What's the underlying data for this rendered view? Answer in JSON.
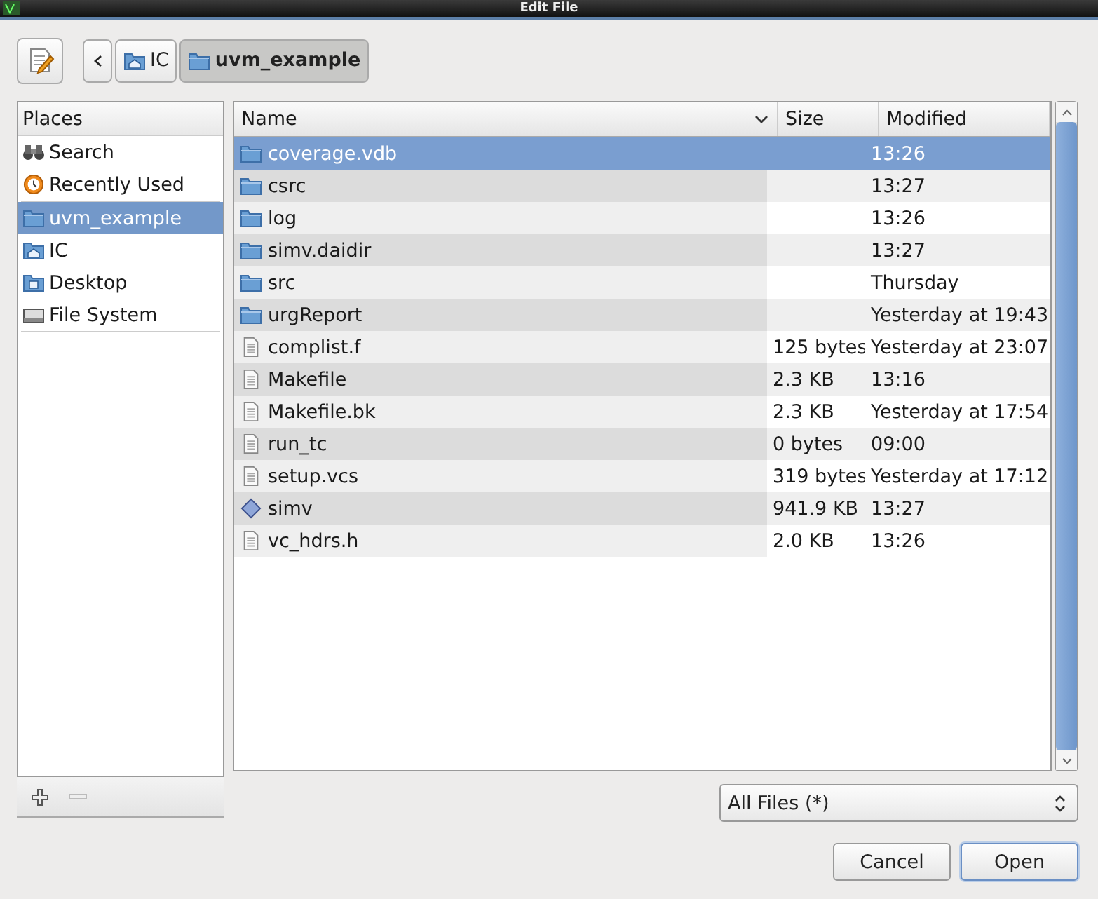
{
  "window": {
    "title": "Edit File"
  },
  "path_bar": {
    "segments": [
      {
        "label": "IC",
        "kind": "home",
        "selected": false
      },
      {
        "label": "uvm_example",
        "kind": "folder",
        "selected": true
      }
    ]
  },
  "places": {
    "header": "Places",
    "groups": [
      {
        "items": [
          {
            "label": "Search",
            "kind": "search",
            "selected": false
          },
          {
            "label": "Recently Used",
            "kind": "recent",
            "selected": false
          }
        ]
      },
      {
        "items": [
          {
            "label": "uvm_example",
            "kind": "folder",
            "selected": true
          },
          {
            "label": "IC",
            "kind": "home",
            "selected": false
          },
          {
            "label": "Desktop",
            "kind": "desktop",
            "selected": false
          },
          {
            "label": "File System",
            "kind": "drive",
            "selected": false
          }
        ]
      }
    ]
  },
  "table": {
    "columns": [
      "Name",
      "Size",
      "Modified"
    ],
    "rows": [
      {
        "name": "coverage.vdb",
        "kind": "folder",
        "size": "",
        "modified": "13:26",
        "selected": true
      },
      {
        "name": "csrc",
        "kind": "folder",
        "size": "",
        "modified": "13:27",
        "selected": false
      },
      {
        "name": "log",
        "kind": "folder",
        "size": "",
        "modified": "13:26",
        "selected": false
      },
      {
        "name": "simv.daidir",
        "kind": "folder",
        "size": "",
        "modified": "13:27",
        "selected": false
      },
      {
        "name": "src",
        "kind": "folder",
        "size": "",
        "modified": "Thursday",
        "selected": false
      },
      {
        "name": "urgReport",
        "kind": "folder",
        "size": "",
        "modified": "Yesterday at 19:43",
        "selected": false
      },
      {
        "name": "complist.f",
        "kind": "file",
        "size": "125 bytes",
        "modified": "Yesterday at 23:07",
        "selected": false
      },
      {
        "name": "Makefile",
        "kind": "file",
        "size": "2.3 KB",
        "modified": "13:16",
        "selected": false
      },
      {
        "name": "Makefile.bk",
        "kind": "file",
        "size": "2.3 KB",
        "modified": "Yesterday at 17:54",
        "selected": false
      },
      {
        "name": "run_tc",
        "kind": "file",
        "size": "0 bytes",
        "modified": "09:00",
        "selected": false
      },
      {
        "name": "setup.vcs",
        "kind": "file",
        "size": "319 bytes",
        "modified": "Yesterday at 17:12",
        "selected": false
      },
      {
        "name": "simv",
        "kind": "executable",
        "size": "941.9 KB",
        "modified": "13:27",
        "selected": false
      },
      {
        "name": "vc_hdrs.h",
        "kind": "file",
        "size": "2.0 KB",
        "modified": "13:26",
        "selected": false
      }
    ]
  },
  "filter": {
    "value": "All Files (*)"
  },
  "buttons": [
    {
      "label": "Cancel",
      "default": false
    },
    {
      "label": "Open",
      "default": true
    }
  ]
}
